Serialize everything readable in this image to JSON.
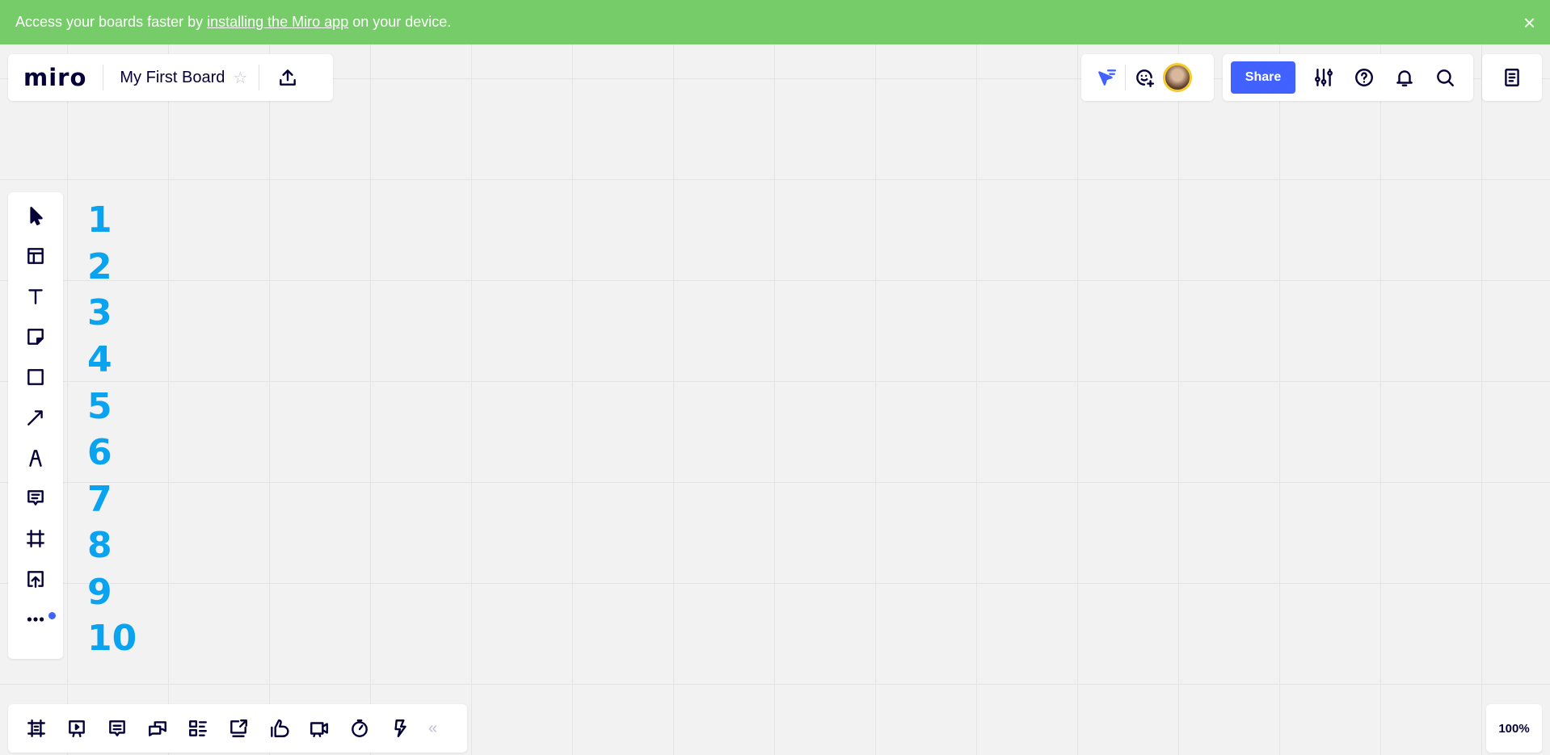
{
  "banner": {
    "text_before": "Access your boards faster by",
    "link": "installing the Miro app",
    "text_after": "on your device.",
    "close": "×",
    "color": "#76cc68"
  },
  "header": {
    "logo": "miro",
    "board_title": "My First Board",
    "star": "☆"
  },
  "toolbar_right": {
    "share_label": "Share",
    "accent": "#4262ff"
  },
  "numbers": [
    "1",
    "2",
    "3",
    "4",
    "5",
    "6",
    "7",
    "8",
    "9",
    "10"
  ],
  "zoom_level": "100%",
  "collapse": "«"
}
